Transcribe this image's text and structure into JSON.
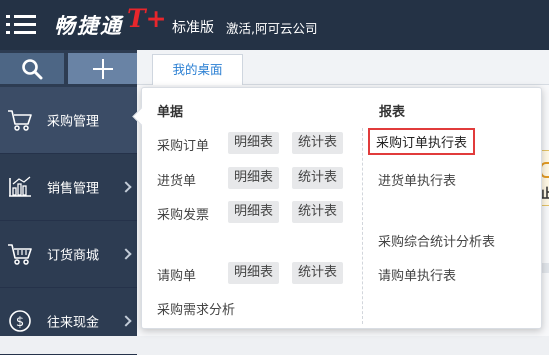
{
  "header": {
    "brand": "畅捷通",
    "brand_mark": "T+",
    "edition": "标准版",
    "activation": "激活,阿可云公司"
  },
  "sidebar": {
    "items": [
      {
        "label": "采购管理",
        "icon": "shopping-cart-icon",
        "active": true
      },
      {
        "label": "销售管理",
        "icon": "bar-chart-icon",
        "active": false
      },
      {
        "label": "订货商城",
        "icon": "store-cart-icon",
        "active": false
      },
      {
        "label": "往来现金",
        "icon": "dollar-coin-icon",
        "active": false
      }
    ]
  },
  "tabs": [
    {
      "label": "我的桌面",
      "active": true
    }
  ],
  "dropdown": {
    "documents_title": "单据",
    "reports_title": "报表",
    "documents": [
      {
        "name": "采购订单",
        "detail": "明细表",
        "stats": "统计表"
      },
      {
        "name": "进货单",
        "detail": "明细表",
        "stats": "统计表"
      },
      {
        "name": "采购发票",
        "detail": "明细表",
        "stats": "统计表"
      },
      {
        "name": "请购单",
        "detail": "明细表",
        "stats": "统计表"
      },
      {
        "name": "采购需求分析"
      }
    ],
    "reports": [
      {
        "label": "采购订单执行表",
        "highlighted": true
      },
      {
        "label": "进货单执行表",
        "highlighted": false
      },
      {
        "label": "采购综合统计分析表",
        "highlighted": false
      },
      {
        "label": "请购单执行表",
        "highlighted": false
      }
    ]
  },
  "background_tile": {
    "text": "止"
  },
  "colors": {
    "topbar": "#243245",
    "sidebar": "#2d3c52",
    "accent_blue": "#2c80d3",
    "brand_red": "#e8262c",
    "highlight_border": "#e13b3b"
  }
}
